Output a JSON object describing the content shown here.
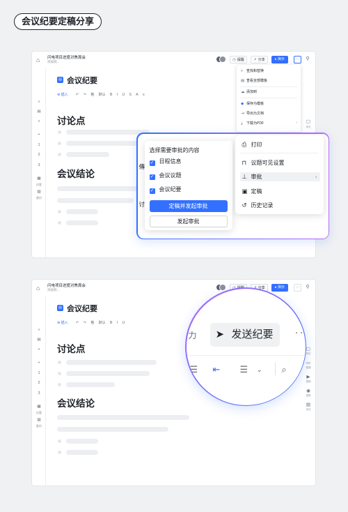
{
  "heading": "会议纪要定稿分享",
  "window": {
    "doc_name": "闪电项目进度对焦周会",
    "doc_sub": "添加到...",
    "btn_remind": "提醒",
    "btn_share": "分享",
    "btn_present": "演示",
    "more": "···",
    "doc_title": "会议纪要",
    "toolbar": [
      "插入",
      "↶",
      "↷",
      "格",
      "默认",
      "B",
      "I",
      "U",
      "S",
      "A",
      "≡",
      "≡",
      "≡",
      "≡",
      "≡",
      "≣",
      "≡"
    ],
    "section1": "讨论点",
    "section2": "会议结论",
    "left_items": [
      "»",
      "▤",
      "+",
      "+",
      "1",
      "2",
      "3"
    ],
    "left_labels": [
      "纪要",
      "备份"
    ],
    "right_labels": [
      "评论",
      "视频",
      "视频",
      "语音",
      "评论"
    ]
  },
  "dropdown": {
    "items": [
      "查找和替换",
      "查看全部模板",
      "添加到",
      "保存为模板",
      "导出为文档",
      "下载为PDF"
    ]
  },
  "zoom": {
    "bg_texts": [
      "傳化",
      "讨排"
    ],
    "left_title": "选择需要审批的内容",
    "checks": [
      "日程信息",
      "会议议题",
      "会议纪要"
    ],
    "btn_primary": "定稿并发起审批",
    "btn_secondary": "发起审批",
    "right_items": [
      "打印",
      "议题可见设置",
      "审批",
      "定稿",
      "历史记录"
    ]
  },
  "magnifier": {
    "send_label": "发送纪要",
    "left_frag": "力",
    "right_frag": "··"
  },
  "colors": {
    "accent": "#3370ff",
    "violet": "#b46cf5"
  }
}
